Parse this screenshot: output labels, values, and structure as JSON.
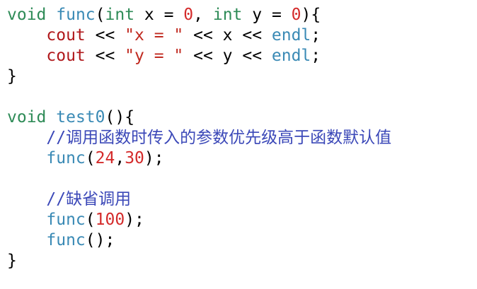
{
  "code": {
    "lines": [
      [
        [
          "kw",
          "void"
        ],
        [
          "plain",
          " "
        ],
        [
          "fn",
          "func"
        ],
        [
          "plain",
          "("
        ],
        [
          "kw",
          "int"
        ],
        [
          "plain",
          " x = "
        ],
        [
          "num",
          "0"
        ],
        [
          "plain",
          ", "
        ],
        [
          "kw",
          "int"
        ],
        [
          "plain",
          " y = "
        ],
        [
          "num",
          "0"
        ],
        [
          "plain",
          "){"
        ]
      ],
      [
        [
          "plain",
          "    "
        ],
        [
          "ident",
          "cout"
        ],
        [
          "plain",
          " << "
        ],
        [
          "str",
          "\"x = \""
        ],
        [
          "plain",
          " << x << "
        ],
        [
          "fn",
          "endl"
        ],
        [
          "plain",
          ";"
        ]
      ],
      [
        [
          "plain",
          "    "
        ],
        [
          "ident",
          "cout"
        ],
        [
          "plain",
          " << "
        ],
        [
          "str",
          "\"y = \""
        ],
        [
          "plain",
          " << y << "
        ],
        [
          "fn",
          "endl"
        ],
        [
          "plain",
          ";"
        ]
      ],
      [
        [
          "plain",
          "}"
        ]
      ],
      [
        [
          "plain",
          ""
        ]
      ],
      [
        [
          "kw",
          "void"
        ],
        [
          "plain",
          " "
        ],
        [
          "fn",
          "test0"
        ],
        [
          "plain",
          "(){"
        ]
      ],
      [
        [
          "plain",
          "    "
        ],
        [
          "cmt",
          "//调用函数时传入的参数优先级高于函数默认值"
        ]
      ],
      [
        [
          "plain",
          "    "
        ],
        [
          "fn",
          "func"
        ],
        [
          "plain",
          "("
        ],
        [
          "num",
          "24"
        ],
        [
          "plain",
          ","
        ],
        [
          "num",
          "30"
        ],
        [
          "plain",
          ");"
        ]
      ],
      [
        [
          "plain",
          ""
        ]
      ],
      [
        [
          "plain",
          "    "
        ],
        [
          "cmt",
          "//缺省调用"
        ]
      ],
      [
        [
          "plain",
          "    "
        ],
        [
          "fn",
          "func"
        ],
        [
          "plain",
          "("
        ],
        [
          "num",
          "100"
        ],
        [
          "plain",
          ");"
        ]
      ],
      [
        [
          "plain",
          "    "
        ],
        [
          "fn",
          "func"
        ],
        [
          "plain",
          "();"
        ]
      ],
      [
        [
          "plain",
          "}"
        ]
      ]
    ]
  },
  "colors": {
    "keyword": "#2e8b57",
    "function": "#3a8ab5",
    "number": "#d42b2b",
    "string": "#c0291f",
    "identifier": "#b0191c",
    "comment": "#3b48b8"
  }
}
